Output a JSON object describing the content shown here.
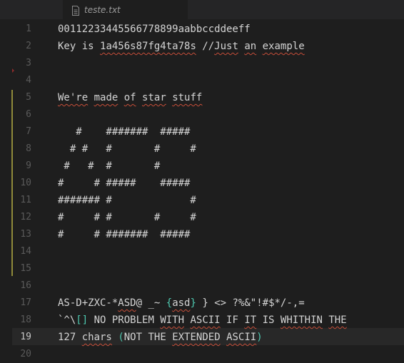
{
  "tab": {
    "filename": "teste.txt",
    "file_icon": "file-icon"
  },
  "gutter": {
    "line_numbers": [
      "1",
      "2",
      "3",
      "4",
      "5",
      "6",
      "7",
      "8",
      "9",
      "10",
      "11",
      "12",
      "13",
      "14",
      "15",
      "16",
      "17",
      "18",
      "19",
      "20"
    ],
    "active_line": "19"
  },
  "editor": {
    "lines": [
      {
        "n": "1",
        "segments": [
          {
            "t": "00112233445566778899aabbccddeeff"
          }
        ]
      },
      {
        "n": "2",
        "segments": [
          {
            "t": "Key"
          },
          {
            "t": " is "
          },
          {
            "t": "1a456s87fg4ta78s",
            "s": 1
          },
          {
            "t": " //"
          },
          {
            "t": "Just",
            "s": 1
          },
          {
            "t": " "
          },
          {
            "t": "an",
            "s": 1
          },
          {
            "t": " "
          },
          {
            "t": "example",
            "s": 1
          }
        ]
      },
      {
        "n": "3",
        "segments": []
      },
      {
        "n": "4",
        "segments": []
      },
      {
        "n": "5",
        "segments": [
          {
            "t": "We're",
            "s": 1
          },
          {
            "t": " "
          },
          {
            "t": "made",
            "s": 1
          },
          {
            "t": " "
          },
          {
            "t": "of",
            "s": 1
          },
          {
            "t": " "
          },
          {
            "t": "star",
            "s": 1
          },
          {
            "t": " "
          },
          {
            "t": "stuff",
            "s": 1
          }
        ]
      },
      {
        "n": "6",
        "segments": []
      },
      {
        "n": "7",
        "segments": [
          {
            "t": "   #    #######  #####"
          }
        ]
      },
      {
        "n": "8",
        "segments": [
          {
            "t": "  # #   #       #     #"
          }
        ]
      },
      {
        "n": "9",
        "segments": [
          {
            "t": " #   #  #       #"
          }
        ]
      },
      {
        "n": "10",
        "segments": [
          {
            "t": "#     # #####    #####"
          }
        ]
      },
      {
        "n": "11",
        "segments": [
          {
            "t": "####### #             #"
          }
        ]
      },
      {
        "n": "12",
        "segments": [
          {
            "t": "#     # #       #     #"
          }
        ]
      },
      {
        "n": "13",
        "segments": [
          {
            "t": "#     # #######  #####"
          }
        ]
      },
      {
        "n": "14",
        "segments": []
      },
      {
        "n": "15",
        "segments": []
      },
      {
        "n": "16",
        "segments": []
      },
      {
        "n": "17",
        "segments": [
          {
            "t": "AS-D+ZXC-*"
          },
          {
            "t": "ASD",
            "s": 1
          },
          {
            "t": "@ _~ "
          },
          {
            "t": "{",
            "b": 1
          },
          {
            "t": "asd",
            "s": 1
          },
          {
            "t": "}",
            "b": 1
          },
          {
            "t": " } <> ?%&\"!#$*/-,="
          }
        ]
      },
      {
        "n": "18",
        "segments": [
          {
            "t": "`^\\"
          },
          {
            "t": "[]",
            "b": 1
          },
          {
            "t": " NO PROBLEM "
          },
          {
            "t": "WITH",
            "s": 1
          },
          {
            "t": " "
          },
          {
            "t": "ASCII",
            "s": 1
          },
          {
            "t": " IF "
          },
          {
            "t": "IT",
            "s": 1
          },
          {
            "t": " IS "
          },
          {
            "t": "WHITHIN",
            "s": 1
          },
          {
            "t": " "
          },
          {
            "t": "THE",
            "s": 1
          }
        ]
      },
      {
        "n": "19",
        "segments": [
          {
            "t": "127 "
          },
          {
            "t": "chars",
            "s": 1
          },
          {
            "t": " "
          },
          {
            "t": "(",
            "b": 1
          },
          {
            "t": "NOT THE "
          },
          {
            "t": "EXTENDED",
            "s": 1
          },
          {
            "t": " "
          },
          {
            "t": "ASCII",
            "s": 1
          },
          {
            "t": ")",
            "b": 1
          }
        ]
      },
      {
        "n": "20",
        "segments": []
      }
    ]
  },
  "colors": {
    "background": "#1e1e1e",
    "text": "#d4d4d4",
    "line_number": "#5a5a5a",
    "spell_squiggle": "#c74e39",
    "bracket": "#4ec9b0",
    "change_bar": "#8f8a3a"
  }
}
